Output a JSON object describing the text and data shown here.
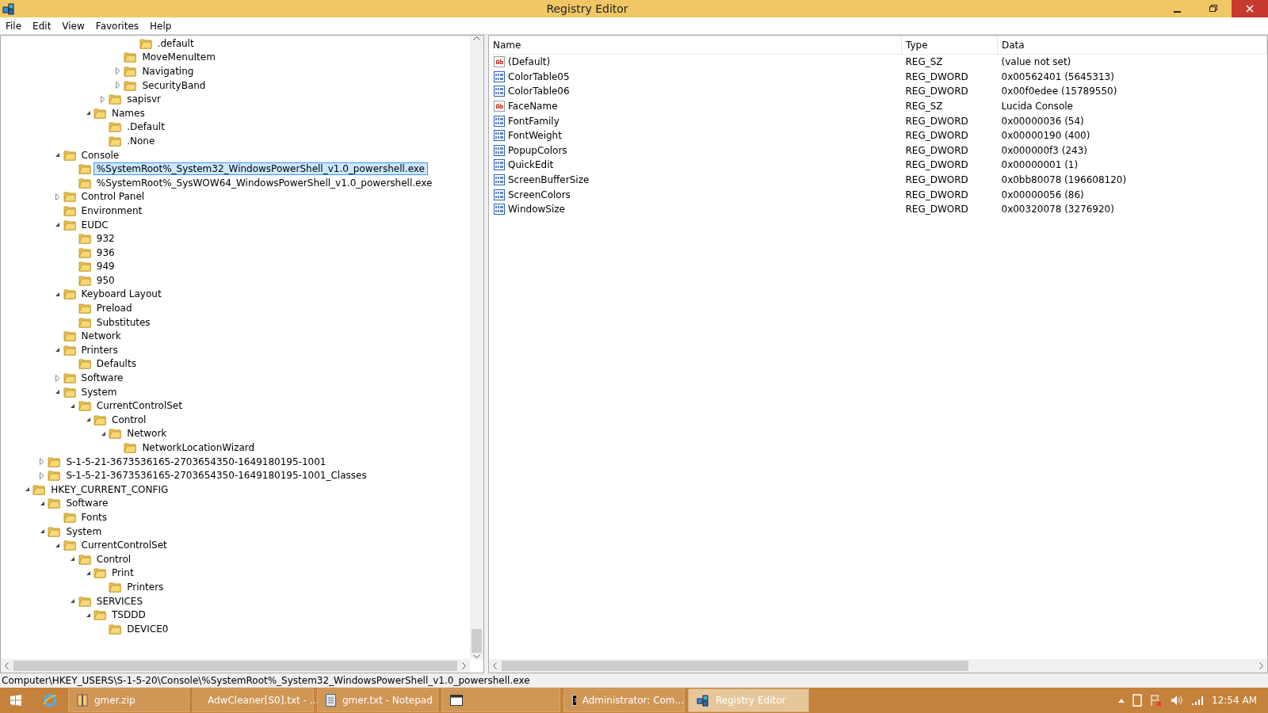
{
  "window": {
    "title": "Registry Editor"
  },
  "menu": [
    "File",
    "Edit",
    "View",
    "Favorites",
    "Help"
  ],
  "tree": [
    {
      "children": [
        {
          "children": [
            {
              "children": [
                {
                  "children": [
                    {
                      "children": [
                        {
                          "children": [
                            {
                              "children": [
                                {
                                  "children": [
                                    {
                                      "label": ".default"
                                    }
                                  ]
                                },
                                {
                                  "label": "MoveMenuItem"
                                },
                                {
                                  "label": "Navigating",
                                  "expanded": false
                                },
                                {
                                  "label": "SecurityBand",
                                  "expanded": false
                                }
                              ]
                            },
                            {
                              "label": "sapisvr",
                              "expanded": false
                            }
                          ]
                        },
                        {
                          "label": "Names",
                          "expanded": true,
                          "children": [
                            {
                              "label": ".Default"
                            },
                            {
                              "label": ".None"
                            }
                          ]
                        }
                      ]
                    }
                  ]
                },
                {
                  "label": "Console",
                  "expanded": true,
                  "children": [
                    {
                      "label": "%SystemRoot%_System32_WindowsPowerShell_v1.0_powershell.exe",
                      "selected": true
                    },
                    {
                      "label": "%SystemRoot%_SysWOW64_WindowsPowerShell_v1.0_powershell.exe",
                      "selected": false
                    }
                  ]
                },
                {
                  "label": "Control Panel",
                  "expanded": false
                },
                {
                  "label": "Environment"
                },
                {
                  "label": "EUDC",
                  "expanded": true,
                  "children": [
                    {
                      "label": "932"
                    },
                    {
                      "label": "936"
                    },
                    {
                      "label": "949"
                    },
                    {
                      "label": "950"
                    }
                  ]
                },
                {
                  "label": "Keyboard Layout",
                  "expanded": true,
                  "children": [
                    {
                      "label": "Preload"
                    },
                    {
                      "label": "Substitutes"
                    }
                  ]
                },
                {
                  "label": "Network"
                },
                {
                  "label": "Printers",
                  "expanded": true,
                  "children": [
                    {
                      "label": "Defaults"
                    }
                  ]
                },
                {
                  "label": "Software",
                  "expanded": false
                },
                {
                  "label": "System",
                  "expanded": true,
                  "children": [
                    {
                      "label": "CurrentControlSet",
                      "expanded": true,
                      "children": [
                        {
                          "label": "Control",
                          "expanded": true,
                          "children": [
                            {
                              "label": "Network",
                              "expanded": true,
                              "children": [
                                {
                                  "label": "NetworkLocationWizard"
                                }
                              ]
                            }
                          ]
                        }
                      ]
                    }
                  ]
                }
              ]
            },
            {
              "label": "S-1-5-21-3673536165-2703654350-1649180195-1001",
              "expanded": false
            },
            {
              "label": "S-1-5-21-3673536165-2703654350-1649180195-1001_Classes",
              "expanded": false
            }
          ]
        },
        {
          "label": "HKEY_CURRENT_CONFIG",
          "expanded": true,
          "children": [
            {
              "label": "Software",
              "expanded": true,
              "children": [
                {
                  "label": "Fonts"
                }
              ]
            },
            {
              "label": "System",
              "expanded": true,
              "children": [
                {
                  "label": "CurrentControlSet",
                  "expanded": true,
                  "children": [
                    {
                      "label": "Control",
                      "expanded": true,
                      "children": [
                        {
                          "label": "Print",
                          "expanded": true,
                          "children": [
                            {
                              "label": "Printers"
                            }
                          ]
                        }
                      ]
                    },
                    {
                      "label": "SERVICES",
                      "expanded": true,
                      "children": [
                        {
                          "label": "TSDDD",
                          "expanded": true,
                          "children": [
                            {
                              "label": "DEVICE0"
                            }
                          ]
                        }
                      ]
                    }
                  ]
                }
              ]
            }
          ]
        }
      ]
    }
  ],
  "values": {
    "columns": [
      "Name",
      "Type",
      "Data"
    ],
    "rows": [
      {
        "kind": "string",
        "name": "(Default)",
        "type": "REG_SZ",
        "data": "(value not set)"
      },
      {
        "kind": "binary",
        "name": "ColorTable05",
        "type": "REG_DWORD",
        "data": "0x00562401 (5645313)"
      },
      {
        "kind": "binary",
        "name": "ColorTable06",
        "type": "REG_DWORD",
        "data": "0x00f0edee (15789550)"
      },
      {
        "kind": "string",
        "name": "FaceName",
        "type": "REG_SZ",
        "data": "Lucida Console"
      },
      {
        "kind": "binary",
        "name": "FontFamily",
        "type": "REG_DWORD",
        "data": "0x00000036 (54)"
      },
      {
        "kind": "binary",
        "name": "FontWeight",
        "type": "REG_DWORD",
        "data": "0x00000190 (400)"
      },
      {
        "kind": "binary",
        "name": "PopupColors",
        "type": "REG_DWORD",
        "data": "0x000000f3 (243)"
      },
      {
        "kind": "binary",
        "name": "QuickEdit",
        "type": "REG_DWORD",
        "data": "0x00000001 (1)"
      },
      {
        "kind": "binary",
        "name": "ScreenBufferSize",
        "type": "REG_DWORD",
        "data": "0x0bb80078 (196608120)"
      },
      {
        "kind": "binary",
        "name": "ScreenColors",
        "type": "REG_DWORD",
        "data": "0x00000056 (86)"
      },
      {
        "kind": "binary",
        "name": "WindowSize",
        "type": "REG_DWORD",
        "data": "0x00320078 (3276920)"
      }
    ]
  },
  "status_bar": "Computer\\HKEY_USERS\\S-1-5-20\\Console\\%SystemRoot%_System32_WindowsPowerShell_v1.0_powershell.exe",
  "taskbar": {
    "items": [
      {
        "kind": "archive",
        "label": "gmer.zip",
        "selected": false
      },
      {
        "kind": "document",
        "label": "AdwCleaner[S0].txt - ...",
        "selected": false
      },
      {
        "kind": "document",
        "label": "gmer.txt - Notepad",
        "selected": false
      },
      {
        "kind": "app",
        "selected": false
      },
      {
        "kind": "console",
        "label": "Administrator: Com...",
        "selected": false
      },
      {
        "kind": "registry",
        "label": "Registry Editor",
        "selected": true
      }
    ],
    "clock": "12:54 AM"
  }
}
